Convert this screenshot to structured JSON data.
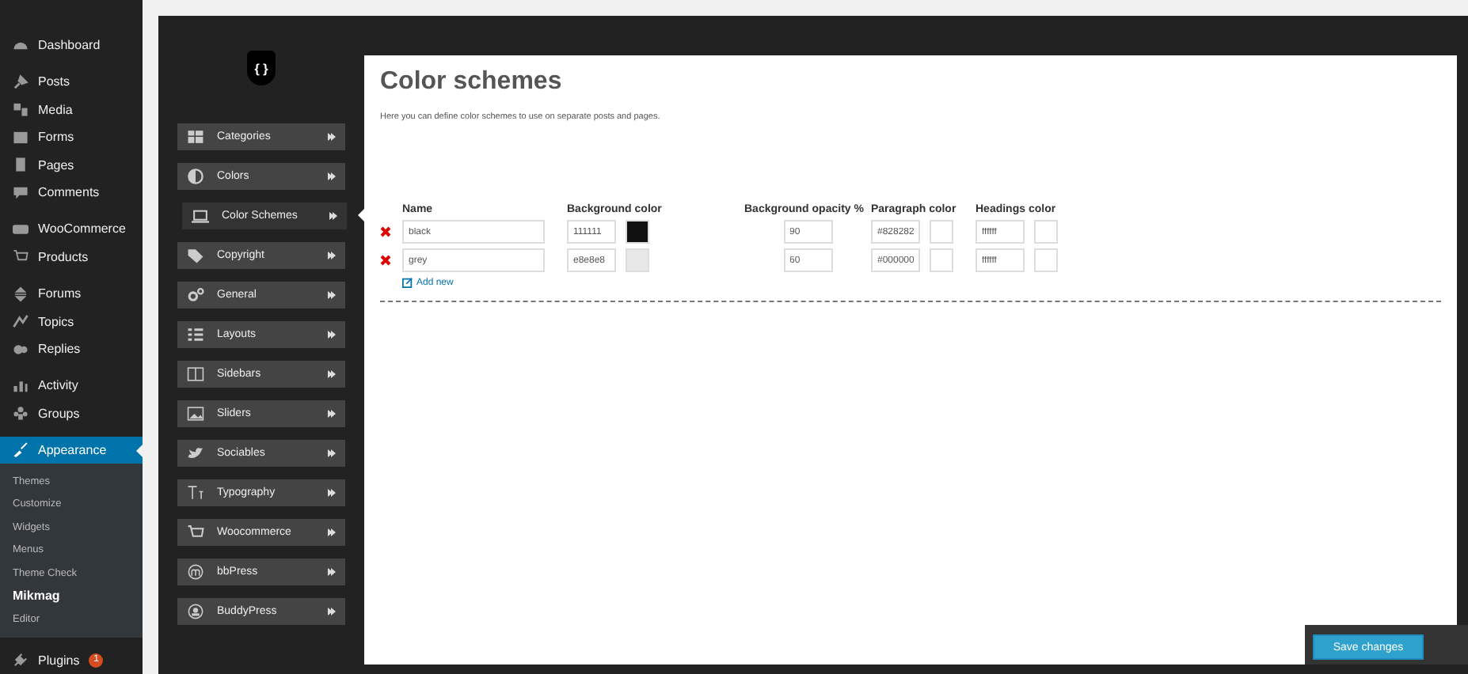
{
  "admin_menu": [
    {
      "label": "Dashboard",
      "selected": false
    },
    {
      "label": "Posts",
      "selected": false
    },
    {
      "label": "Media",
      "selected": false
    },
    {
      "label": "Forms",
      "selected": false
    },
    {
      "label": "Pages",
      "selected": false
    },
    {
      "label": "Comments",
      "selected": false
    },
    {
      "label": "WooCommerce",
      "selected": false
    },
    {
      "label": "Products",
      "selected": false
    },
    {
      "label": "Forums",
      "selected": false
    },
    {
      "label": "Topics",
      "selected": false
    },
    {
      "label": "Replies",
      "selected": false
    },
    {
      "label": "Activity",
      "selected": false
    },
    {
      "label": "Groups",
      "selected": false
    },
    {
      "label": "Appearance",
      "selected": true,
      "children": [
        {
          "label": "Themes",
          "selected": false
        },
        {
          "label": "Customize",
          "selected": false
        },
        {
          "label": "Widgets",
          "selected": false
        },
        {
          "label": "Menus",
          "selected": false
        },
        {
          "label": "Theme Check",
          "selected": false
        },
        {
          "label": "Mikmag",
          "selected": true
        },
        {
          "label": "Editor",
          "selected": false
        }
      ]
    },
    {
      "label": "Plugins",
      "selected": false,
      "badge": "1"
    }
  ],
  "logo": {
    "text": "{ }"
  },
  "options_menu": [
    {
      "label": "Categories",
      "selected": false
    },
    {
      "label": "Colors",
      "selected": false
    },
    {
      "label": "Color Schemes",
      "selected": true
    },
    {
      "label": "Copyright",
      "selected": false
    },
    {
      "label": "General",
      "selected": false
    },
    {
      "label": "Layouts",
      "selected": false
    },
    {
      "label": "Sidebars",
      "selected": false
    },
    {
      "label": "Sliders",
      "selected": false
    },
    {
      "label": "Sociables",
      "selected": false
    },
    {
      "label": "Typography",
      "selected": false
    },
    {
      "label": "Woocommerce",
      "selected": false
    },
    {
      "label": "bbPress",
      "selected": false
    },
    {
      "label": "BuddyPress",
      "selected": false
    }
  ],
  "page": {
    "title": "Color schemes",
    "description": "Here you can define color schemes to use on separate posts and pages."
  },
  "table": {
    "columns": [
      "Name",
      "Background color",
      "Background opacity %",
      "Paragraph color",
      "Headings color"
    ],
    "rows": [
      {
        "name": "black",
        "background": {
          "value": "111111",
          "color": "#111111"
        },
        "opacity": "90",
        "paragraph": {
          "value": "#828282",
          "color": "#ffffff"
        },
        "headings": {
          "value": "ffffff",
          "color": "#ffffff"
        }
      },
      {
        "name": "grey",
        "background": {
          "value": "e8e8e8",
          "color": "#e8e8e8"
        },
        "opacity": "60",
        "paragraph": {
          "value": "#000000",
          "color": "#ffffff"
        },
        "headings": {
          "value": "ffffff",
          "color": "#ffffff"
        }
      }
    ]
  },
  "add_new": "Add new",
  "save_button": "Save changes"
}
